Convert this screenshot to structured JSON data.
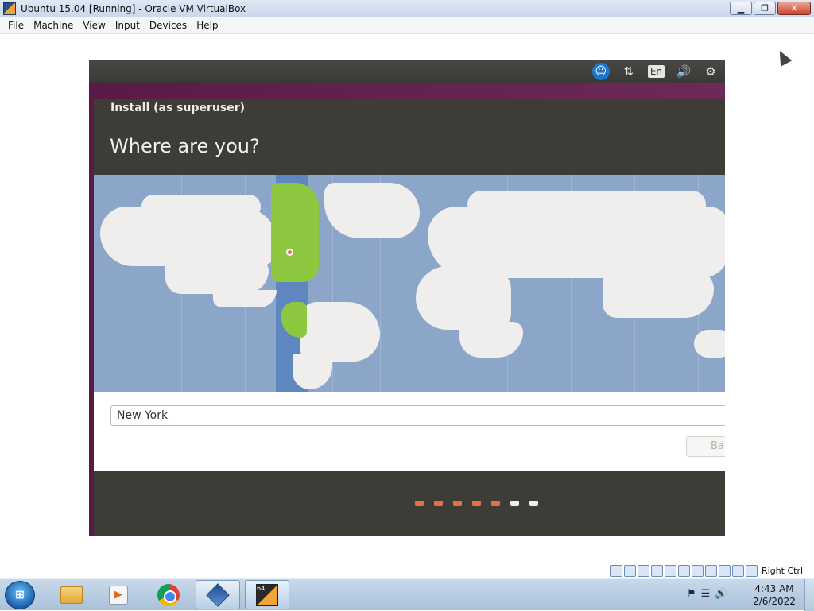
{
  "window": {
    "title": "Ubuntu 15.04 [Running] - Oracle VM VirtualBox",
    "minimize_icon": "minimize-icon",
    "restore_icon": "restore-icon",
    "close_icon": "close-icon"
  },
  "menu": {
    "items": [
      "File",
      "Machine",
      "View",
      "Input",
      "Devices",
      "Help"
    ]
  },
  "guest_topbar": {
    "icons": [
      "accessibility-icon",
      "network-icon",
      "keyboard-layout-indicator",
      "volume-icon",
      "settings-gear-icon"
    ],
    "keyboard_layout": "En"
  },
  "installer": {
    "window_title": "Install (as superuser)",
    "heading": "Where are you?",
    "timezone_value": "New York",
    "back_button": "Ba",
    "progress": {
      "total_steps": 7,
      "completed_steps": 5
    }
  },
  "vbox_status": {
    "host_key": "Right Ctrl"
  },
  "taskbar": {
    "apps": [
      "windows-explorer",
      "media-player",
      "google-chrome",
      "oracle-vm-virtualbox",
      "ubuntu-vm"
    ],
    "time": "4:43 AM",
    "date": "2/6/2022"
  },
  "colors": {
    "ubuntu_header": "#3d3c37",
    "map_ocean": "#8ba6c8",
    "selected_timezone": "#8dc63f",
    "progress_done": "#e4704a"
  }
}
